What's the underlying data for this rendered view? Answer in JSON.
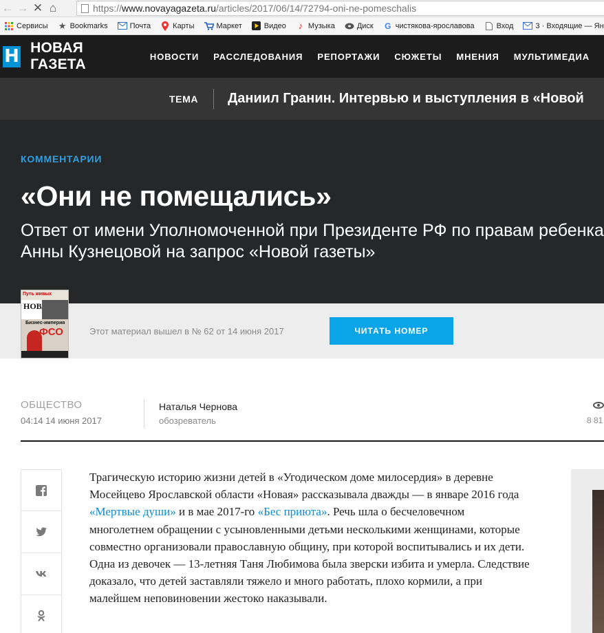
{
  "browser": {
    "url_prefix": "https://",
    "url_host": "www.novayagazeta.ru",
    "url_path": "/articles/2017/06/14/72794-oni-ne-pomeschalis",
    "bookmarks": [
      {
        "label": "Сервисы",
        "icon": "apps-grid-icon"
      },
      {
        "label": "Bookmarks",
        "icon": "star-icon"
      },
      {
        "label": "Почта",
        "icon": "mail-icon"
      },
      {
        "label": "Карты",
        "icon": "map-pin-icon"
      },
      {
        "label": "Маркет",
        "icon": "cart-icon"
      },
      {
        "label": "Видео",
        "icon": "play-icon"
      },
      {
        "label": "Музыка",
        "icon": "music-note-icon"
      },
      {
        "label": "Диск",
        "icon": "disk-icon"
      },
      {
        "label": "чистякова-ярославова",
        "icon": "google-icon"
      },
      {
        "label": "Вход",
        "icon": "page-icon"
      },
      {
        "label": "3 · Входящие — Ян",
        "icon": "inbox-icon"
      }
    ]
  },
  "site": {
    "logo_letter": "Н",
    "logo_text": "НОВАЯ ГАЗЕТА",
    "nav": [
      "НОВОСТИ",
      "РАССЛЕДОВАНИЯ",
      "РЕПОРТАЖИ",
      "СЮЖЕТЫ",
      "МНЕНИЯ",
      "МУЛЬТИМЕДИА"
    ],
    "colors": {
      "accent": "#0093d5",
      "button": "#0aa5e9",
      "link": "#0a8cd6"
    }
  },
  "topic": {
    "label": "ТЕМА",
    "title": "Даниил Гранин. Интервью и выступления в «Новой"
  },
  "article": {
    "rubric": "КОММЕНТАРИИ",
    "headline": "«Они не помещались»",
    "subheadline": "Ответ от имени Уполномоченной при Президенте РФ по правам ребенка Анны Кузнецовой на запрос «Новой газеты»",
    "issue": {
      "cover_top": "Путь живых",
      "cover_logo": "НОВАЯ",
      "cover_headline": "Бизнес-империя",
      "cover_big": "ФСО",
      "text": "Этот материал вышел в № 62 от 14 июня 2017",
      "button": "ЧИТАТЬ НОМЕР"
    },
    "section": "ОБЩЕСТВО",
    "date": "04:14 14 июня 2017",
    "author": "Наталья Чернова",
    "author_role": "обозреватель",
    "views": "8 81",
    "body": {
      "p1": "Трагическую историю жизни детей в «Угодическом доме милосердия» в деревне Мосейцево Ярославской области «Новая» рассказывала дважды — в январе 2016 года ",
      "link1": "«Мертвые души»",
      "p2": " и в мае 2017-го ",
      "link2": "«Бес приюта»",
      "p3": ". Речь шла о бесчеловечном многолетнем обращении с усыновленными детьми несколькими женщинами, которые совместно организовали православную общину, при которой воспитывались и их дети. Одна из девочек — 13-летняя Таня Любимова была зверски избита и умерла. Следствие доказало, что детей заставляли тяжело и много работать, плохо кормили, а при малейшем неповиновении жестоко наказывали."
    }
  }
}
